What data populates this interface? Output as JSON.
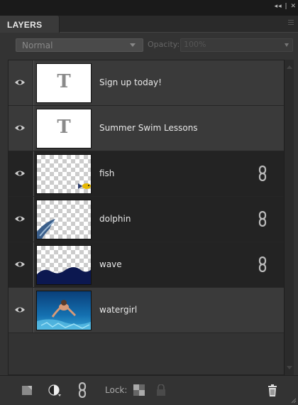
{
  "panel": {
    "tab_label": "LAYERS",
    "top_controls": "◂◂ | ✕"
  },
  "blend": {
    "mode": "Normal",
    "opacity_label": "Opacity:",
    "opacity_value": "100%"
  },
  "layers": [
    {
      "name": "Sign up today!",
      "thumbnail": "text-layer-icon",
      "linked": false,
      "visible": true
    },
    {
      "name": "Summer Swim Lessons",
      "thumbnail": "text-layer-icon",
      "linked": false,
      "visible": true
    },
    {
      "name": "fish",
      "thumbnail": "transparent-with-fish",
      "linked": true,
      "visible": true
    },
    {
      "name": "dolphin",
      "thumbnail": "transparent-with-dolphin",
      "linked": true,
      "visible": true
    },
    {
      "name": "wave",
      "thumbnail": "transparent-with-wave",
      "linked": true,
      "visible": true
    },
    {
      "name": "watergirl",
      "thumbnail": "underwater-photo",
      "linked": false,
      "visible": true
    }
  ],
  "text_thumb_glyph": "T",
  "bottom": {
    "lock_label": "Lock:"
  },
  "colors": {
    "panel_bg": "#333333",
    "row_light": "#3a3a3a",
    "row_dark": "#232323",
    "text": "#e8e8e8",
    "wave_blue": "#0c1850"
  }
}
